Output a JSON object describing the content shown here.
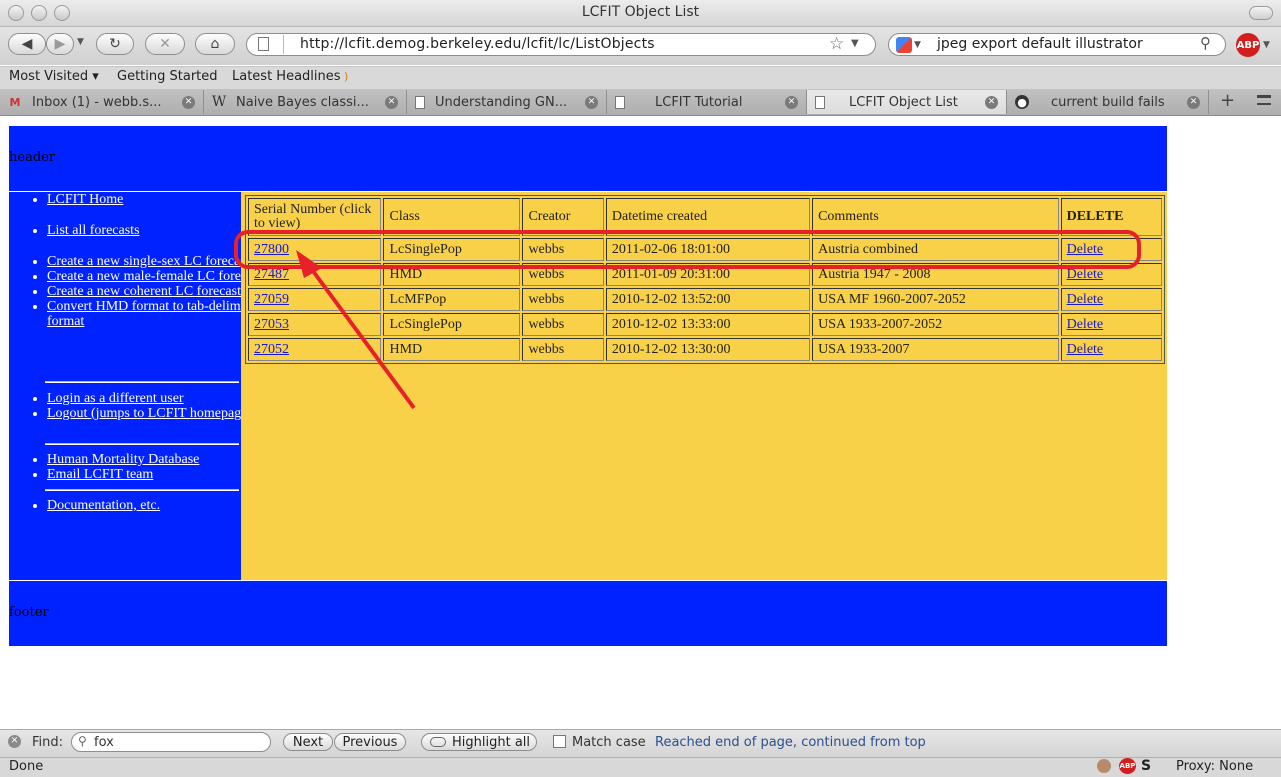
{
  "window": {
    "title": "LCFIT Object List"
  },
  "nav": {
    "url": "http://lcfit.demog.berkeley.edu/lcfit/lc/ListObjects",
    "search_value": "jpeg export default illustrator",
    "adblock_label": "ABP"
  },
  "bookmarks": [
    {
      "label": "Most Visited ▾"
    },
    {
      "label": "Getting Started"
    },
    {
      "label": "Latest Headlines"
    }
  ],
  "tabs": [
    {
      "label": "Inbox (1) - webb.s...",
      "icon": "mail-icon"
    },
    {
      "label": "Naive Bayes classi...",
      "icon": "wikipedia-icon"
    },
    {
      "label": "Understanding GN...",
      "icon": "page-icon"
    },
    {
      "label": "LCFIT Tutorial",
      "icon": "page-icon"
    },
    {
      "label": "LCFIT Object List",
      "icon": "page-icon"
    },
    {
      "label": "current build fails",
      "icon": "github-icon"
    }
  ],
  "page": {
    "header_text": "header",
    "footer_text": "footer",
    "sidebar": {
      "group1": [
        "LCFIT Home",
        "List all forecasts",
        "Create a new single-sex LC forecast",
        "Create a new male-female LC forecast",
        "Create a new coherent LC forecast",
        "Convert HMD format to tab-delimited format"
      ],
      "group2": [
        "Login as a different user",
        "Logout (jumps to LCFIT homepage)"
      ],
      "group3": [
        "Human Mortality Database",
        "Email LCFIT team"
      ],
      "group4": [
        "Documentation, etc."
      ]
    },
    "table": {
      "headers": [
        "Serial Number (click to view)",
        "Class",
        "Creator",
        "Datetime created",
        "Comments",
        "DELETE"
      ],
      "rows": [
        {
          "serial": "27800",
          "class": "LcSinglePop",
          "creator": "webbs",
          "datetime": "2011-02-06 18:01:00",
          "comments": "Austria combined",
          "delete": "Delete"
        },
        {
          "serial": "27487",
          "class": "HMD",
          "creator": "webbs",
          "datetime": "2011-01-09 20:31:00",
          "comments": "Austria 1947 - 2008",
          "delete": "Delete"
        },
        {
          "serial": "27059",
          "class": "LcMFPop",
          "creator": "webbs",
          "datetime": "2010-12-02 13:52:00",
          "comments": "USA MF 1960-2007-2052",
          "delete": "Delete"
        },
        {
          "serial": "27053",
          "class": "LcSinglePop",
          "creator": "webbs",
          "datetime": "2010-12-02 13:33:00",
          "comments": "USA 1933-2007-2052",
          "delete": "Delete"
        },
        {
          "serial": "27052",
          "class": "HMD",
          "creator": "webbs",
          "datetime": "2010-12-02 13:30:00",
          "comments": "USA 1933-2007",
          "delete": "Delete"
        }
      ]
    }
  },
  "findbar": {
    "label": "Find:",
    "value": "fox",
    "next_label": "Next",
    "previous_label": "Previous",
    "highlight_label": "Highlight all",
    "match_case_label": "Match case",
    "message": "Reached end of page, continued from top"
  },
  "status": {
    "left": "Done",
    "proxy": "Proxy: None"
  },
  "colors": {
    "page_blue": "#0022ff",
    "page_gold": "#f8d149",
    "annotation_red": "#e8202a",
    "find_message": "#2a4f8c"
  }
}
